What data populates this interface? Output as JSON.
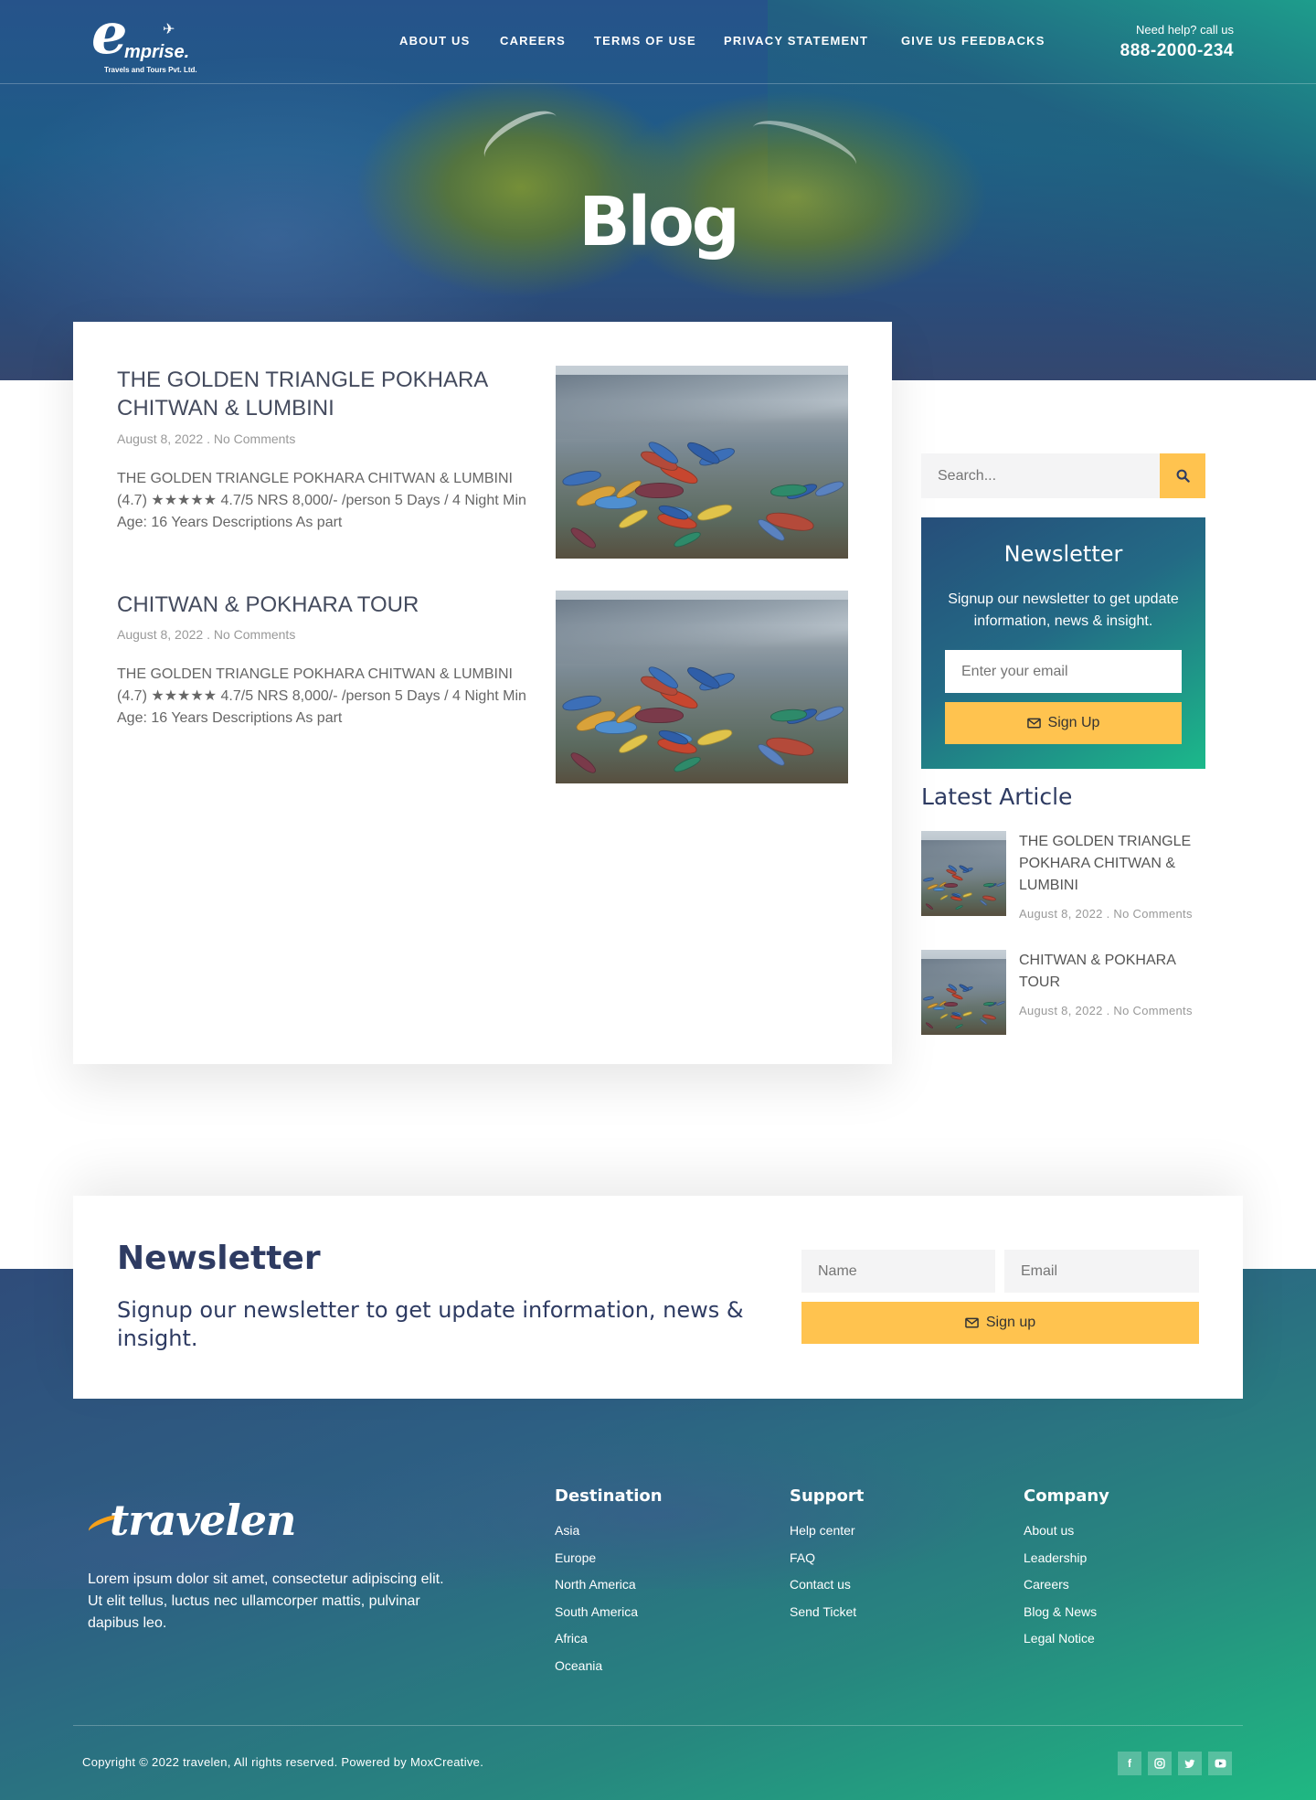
{
  "header": {
    "logo": {
      "name": "mprise.",
      "initial": "e",
      "tagline": "Travels and Tours Pvt. Ltd."
    },
    "nav": [
      "ABOUT US",
      "CAREERS",
      "TERMS OF USE",
      "PRIVACY STATEMENT",
      "GIVE US FEEDBACKS"
    ],
    "help_label": "Need help? call us",
    "help_phone": "888-2000-234"
  },
  "hero": {
    "title": "Blog"
  },
  "posts": [
    {
      "title": "THE GOLDEN TRIANGLE POKHARA CHITWAN & LUMBINI",
      "meta": "August 8, 2022 . No Comments",
      "excerpt": "THE GOLDEN TRIANGLE POKHARA CHITWAN & LUMBINI (4.7) ★★★★★ 4.7/5 NRS 8,000/- /person 5 Days / 4 Night Min Age: 16 Years Descriptions As part"
    },
    {
      "title": "CHITWAN & POKHARA TOUR",
      "meta": "August 8, 2022 . No Comments",
      "excerpt": "THE GOLDEN TRIANGLE POKHARA CHITWAN & LUMBINI (4.7) ★★★★★ 4.7/5 NRS 8,000/- /person 5 Days / 4 Night Min Age: 16 Years Descriptions As part"
    }
  ],
  "sidebar": {
    "search_placeholder": "Search...",
    "newsletter": {
      "title": "Newsletter",
      "text": "Signup our newsletter to get update information, news & insight.",
      "email_placeholder": "Enter your email",
      "button": "Sign Up"
    },
    "latest_title": "Latest Article",
    "latest": [
      {
        "title": "THE GOLDEN TRIANGLE POKHARA CHITWAN & LUMBINI",
        "meta": "August 8, 2022 . No Comments"
      },
      {
        "title": "CHITWAN & POKHARA TOUR",
        "meta": "August 8, 2022 . No Comments"
      }
    ]
  },
  "newsletter_band": {
    "title": "Newsletter",
    "subtitle": "Signup our newsletter to get update information, news & insight.",
    "name_placeholder": "Name",
    "email_placeholder": "Email",
    "button": "Sign up"
  },
  "footer": {
    "logo": "travelen",
    "about": "Lorem ipsum dolor sit amet, consectetur adipiscing elit. Ut elit tellus, luctus nec ullamcorper mattis, pulvinar dapibus leo.",
    "columns": [
      {
        "title": "Destination",
        "links": [
          "Asia",
          "Europe",
          "North America",
          "South America",
          "Africa",
          "Oceania"
        ]
      },
      {
        "title": "Support",
        "links": [
          "Help center",
          "FAQ",
          "Contact us",
          "Send Ticket"
        ]
      },
      {
        "title": "Company",
        "links": [
          "About us",
          "Leadership",
          "Careers",
          "Blog & News",
          "Legal Notice"
        ]
      }
    ],
    "copyright": "Copyright © 2022 travelen, All rights reserved. Powered by MoxCreative.",
    "social": [
      "facebook-icon",
      "instagram-icon",
      "twitter-icon",
      "youtube-icon"
    ]
  },
  "colors": {
    "accent": "#ffc34f",
    "navy": "#2e3b62",
    "teal": "#1fb882"
  }
}
